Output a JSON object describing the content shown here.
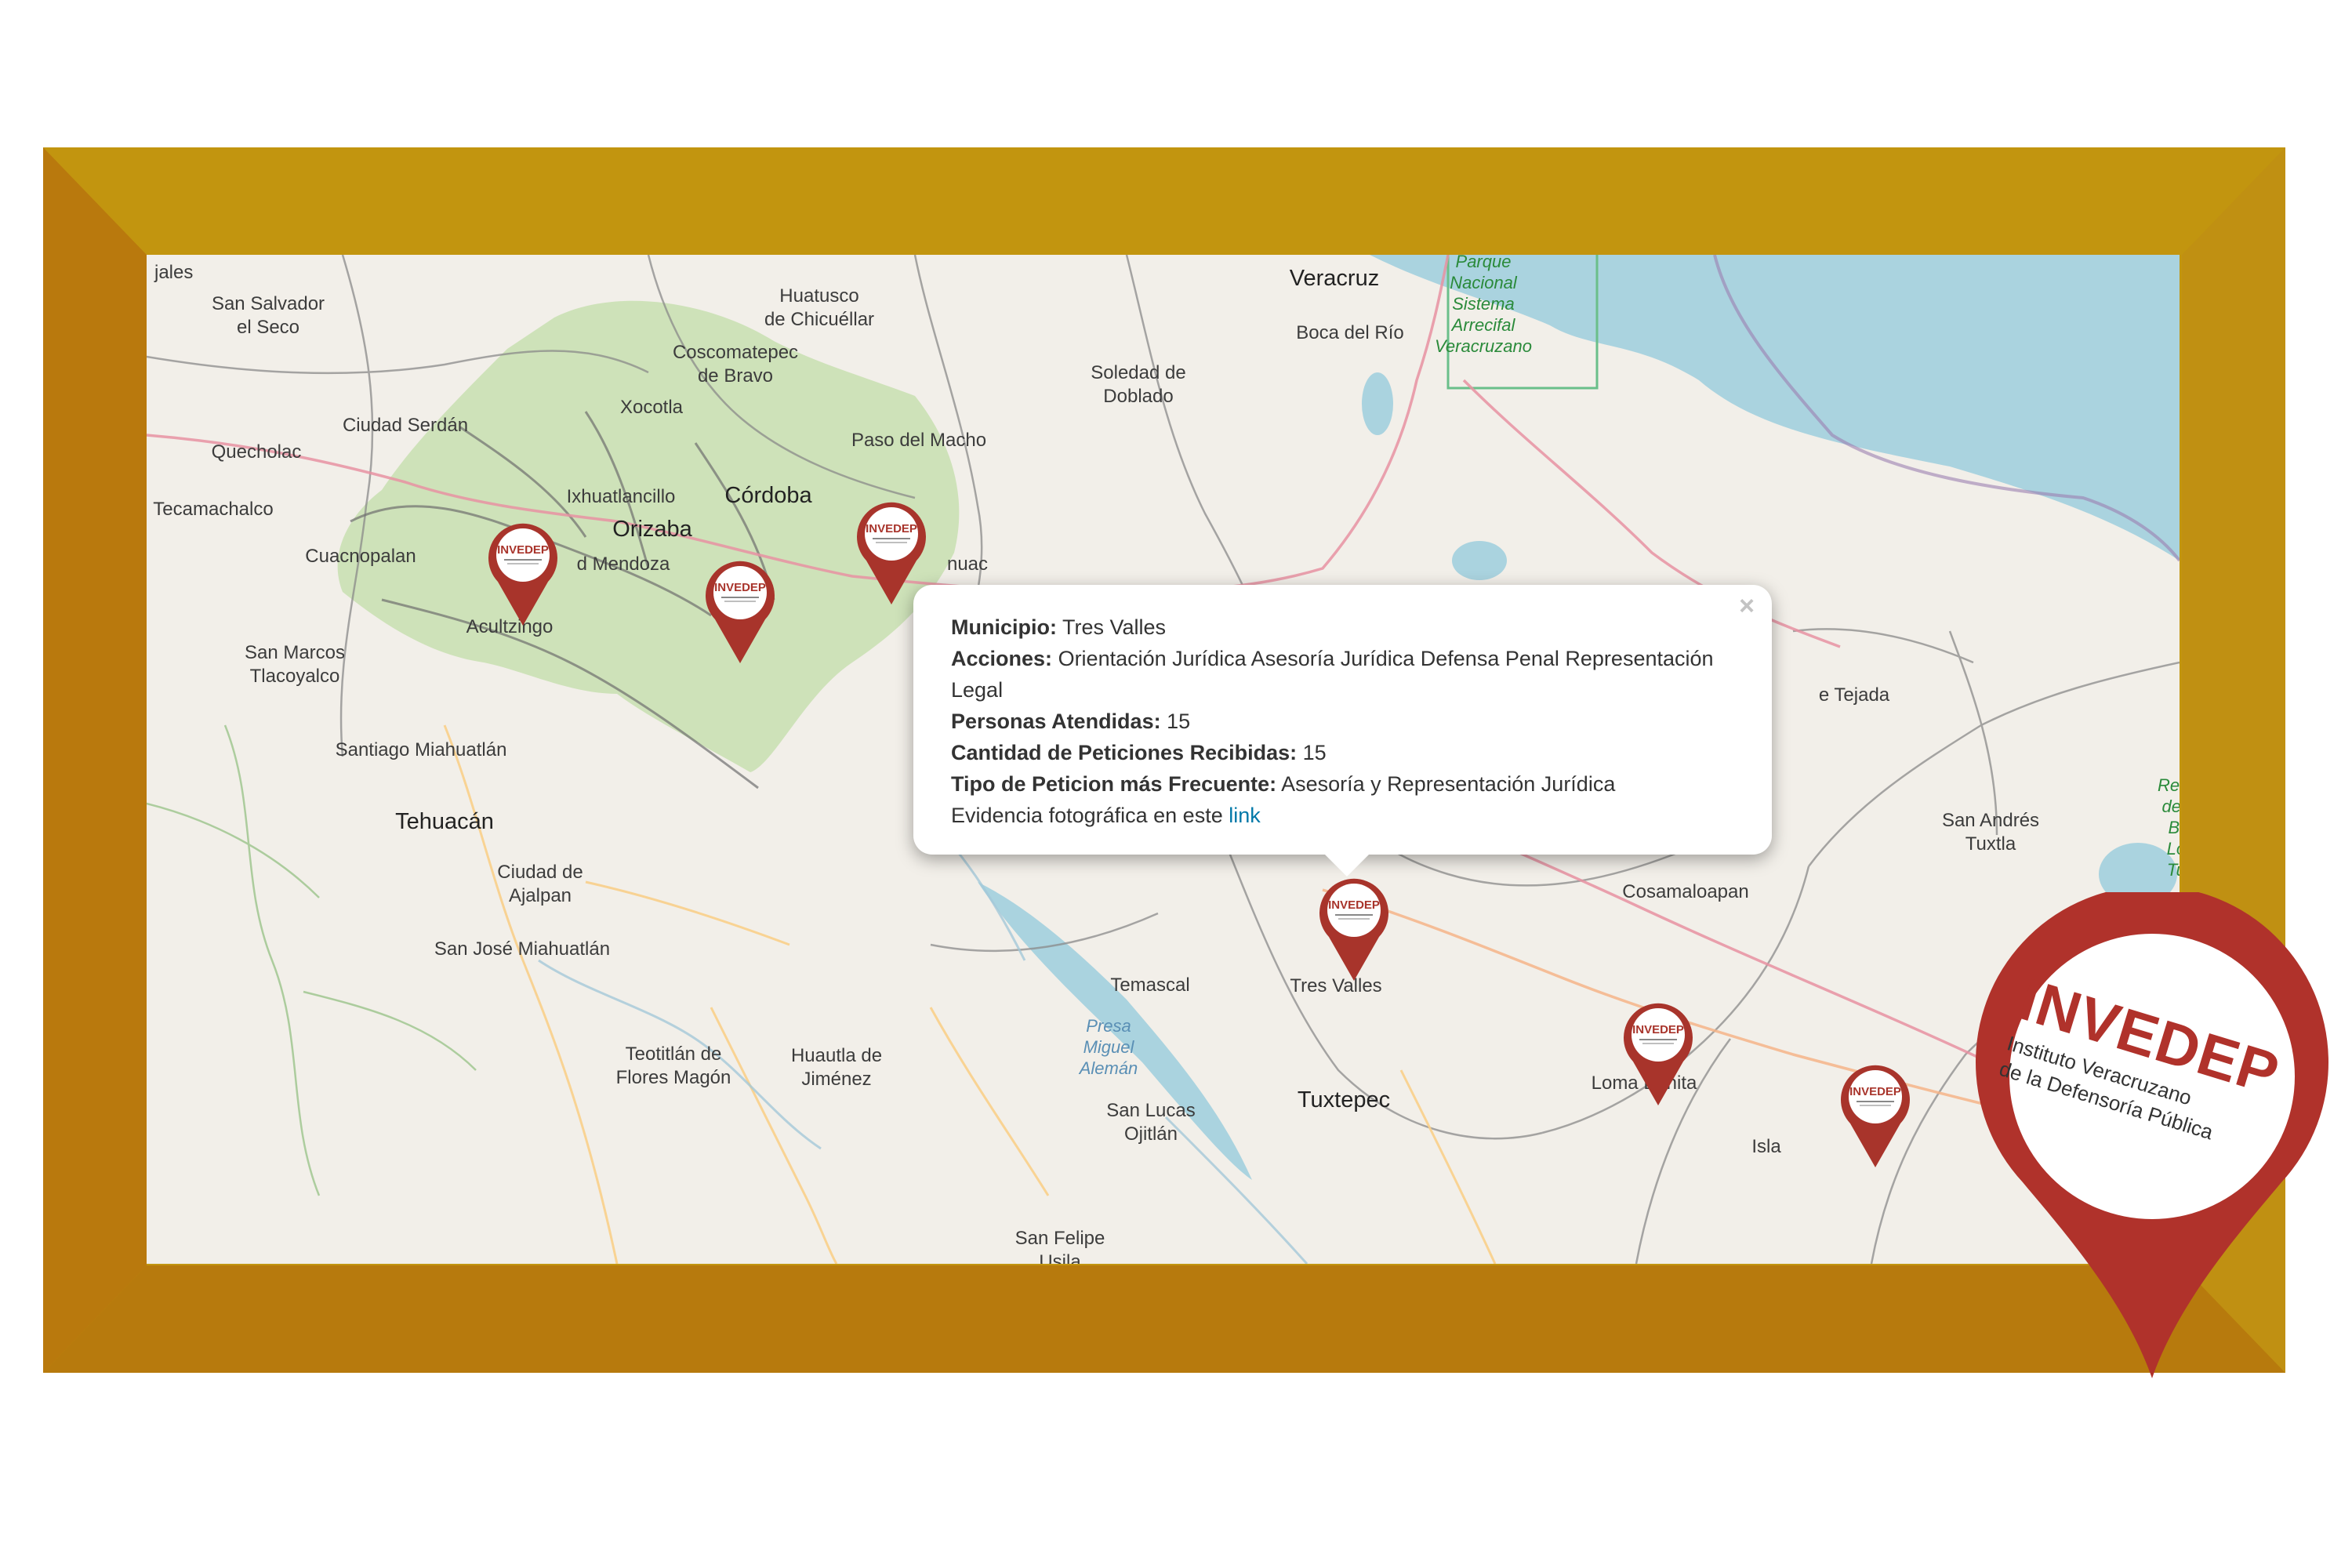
{
  "colors": {
    "frame": "#c2950f",
    "frame_shadow": "#b5740c",
    "marker": "#a8342b",
    "water": "#aad3df",
    "land": "#f2efe9",
    "park": "#c8dfb0",
    "link": "#0078a8"
  },
  "places": {
    "veracruz": "Veracruz",
    "parque": "Parque\nNacional\nSistema\nArrecifal\nVeracruzano",
    "boca_del_rio": "Boca del Río",
    "huatusco": "Huatusco\nde Chicuéllar",
    "san_salvador": "San Salvador\nel Seco",
    "coscomatepec": "Coscomatepec\nde Bravo",
    "xocotla": "Xocotla",
    "soledad": "Soledad de\nDoblado",
    "ciudad_serdan": "Ciudad Serdán",
    "quecholac": "Quecholac",
    "paso_macho": "Paso del Macho",
    "ixhuatlancillo": "Ixhuatlancillo",
    "cordoba": "Córdoba",
    "tecamachalco": "Tecamachalco",
    "orizaba": "Orizaba",
    "cuacnopalan": "Cuacnopalan",
    "ciudad_mendoza": "d Mendoza",
    "acultzingo": "Acultzingo",
    "san_marcos": "San Marcos\nTlacoyalco",
    "santiago": "Santiago Miahuatlán",
    "tehuacan": "Tehuacán",
    "ciudad_ajalpan": "Ciudad de\nAjalpan",
    "san_jose": "San José Miahuatlán",
    "temascal": "Temascal",
    "tres_valles": "Tres Valles",
    "presa": "Presa\nMiguel\nAlemán",
    "teotitlan": "Teotitlán de\nFlores Magón",
    "huautla": "Huautla de\nJiménez",
    "san_lucas": "San Lucas\nOjitlán",
    "tuxtepec": "Tuxtepec",
    "loma_bonita": "Loma Bonita",
    "isla": "Isla",
    "cosamaloapan": "Cosamaloapan",
    "san_andres": "San Andrés\nTuxtla",
    "reserva": "Reser\nde la Bio\nLos Tux",
    "tejada": "e Tejada",
    "san_felipe": "San Felipe\nUsila",
    "jales": "jales",
    "nuac": "nuac"
  },
  "popup": {
    "municipio_label": "Municipio:",
    "municipio_value": "Tres Valles",
    "acciones_label": "Acciones:",
    "acciones_value": "Orientación Jurídica Asesoría Jurídica Defensa Penal Representación Legal",
    "personas_label": "Personas Atendidas:",
    "personas_value": "15",
    "peticiones_label": "Cantidad de Peticiones Recibidas:",
    "peticiones_value": "15",
    "tipo_label": "Tipo de Peticion más Frecuente:",
    "tipo_value": "Asesoría y Representación Jurídica",
    "evidencia_text": "Evidencia fotográfica en este",
    "evidencia_link": "link",
    "close": "×"
  },
  "marker_logo": "INVEDEP",
  "badge": {
    "title": "INVEDEP",
    "subtitle_line1": "Instituto Veracruzano",
    "subtitle_line2": "de la Defensoría Pública"
  }
}
